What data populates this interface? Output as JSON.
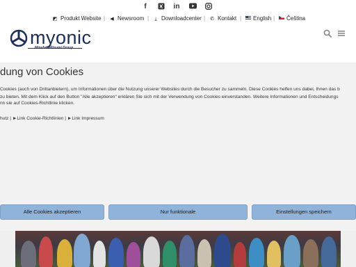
{
  "topbar": {
    "social_icons": [
      "facebook-icon",
      "xing-icon",
      "linkedin-icon",
      "youtube-icon",
      "instagram-icon"
    ],
    "links": [
      {
        "label": "Produkt Website",
        "icon": "external-link-icon"
      },
      {
        "label": "Newsroom",
        "icon": "megaphone-icon"
      },
      {
        "label": "Downloadcenter",
        "icon": "download-icon"
      },
      {
        "label": "Kontakt",
        "icon": "phone-icon"
      },
      {
        "label": "English",
        "icon": "flag-uk-icon"
      },
      {
        "label": "Čeština",
        "icon": "flag-cz-icon"
      }
    ]
  },
  "header": {
    "logo_text": "myonic",
    "logo_subtext": "MinebeaMitsumi Group",
    "icons": [
      "search-icon",
      "menu-icon"
    ]
  },
  "cookie": {
    "title": "dung von Cookies",
    "text_lines": [
      "Cookies (auch von Drittanbietern), um Informationen über die Nutzung unserer Websites durch die Besucher zu sammeln. Diese Cookies helfen uns dabei, Ihnen das b",
      "zu bieten. Mit dem Klick auf den Button \"Alle akzeptieren\" erklären Sie sich mit der Verwendung von Cookies einverstanden. Weitere Informationen und Entscheidungs",
      "nn sie auf Cookies-Richtlinie klicken."
    ],
    "links_line": "hutz | ►Link Cookie-Richtlinien | ►Link Impressum",
    "buttons": {
      "accept_all": "Alle Cookies akzeptieren",
      "functional": "Nur funktionale",
      "save": "Einstellungen speichern"
    }
  },
  "colors": {
    "brand": "#1b2d5c",
    "button": "#8fb3d9",
    "overlay_bg": "#f2f2f2"
  }
}
